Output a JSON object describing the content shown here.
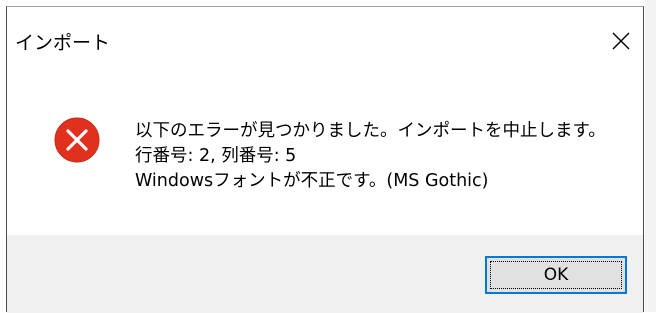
{
  "dialog": {
    "title": "インポート",
    "close_icon": "close-icon",
    "error_icon": "error-icon",
    "message": {
      "line1": "以下のエラーが見つかりました。インポートを中止します。",
      "line2": "行番号: 2, 列番号: 5",
      "line3": "Windowsフォントが不正です。(MS Gothic)"
    },
    "ok_label": "OK"
  },
  "colors": {
    "error_red": "#e0301e",
    "footer_bg": "#f0f0f0",
    "button_focus_border": "#0078d7"
  }
}
